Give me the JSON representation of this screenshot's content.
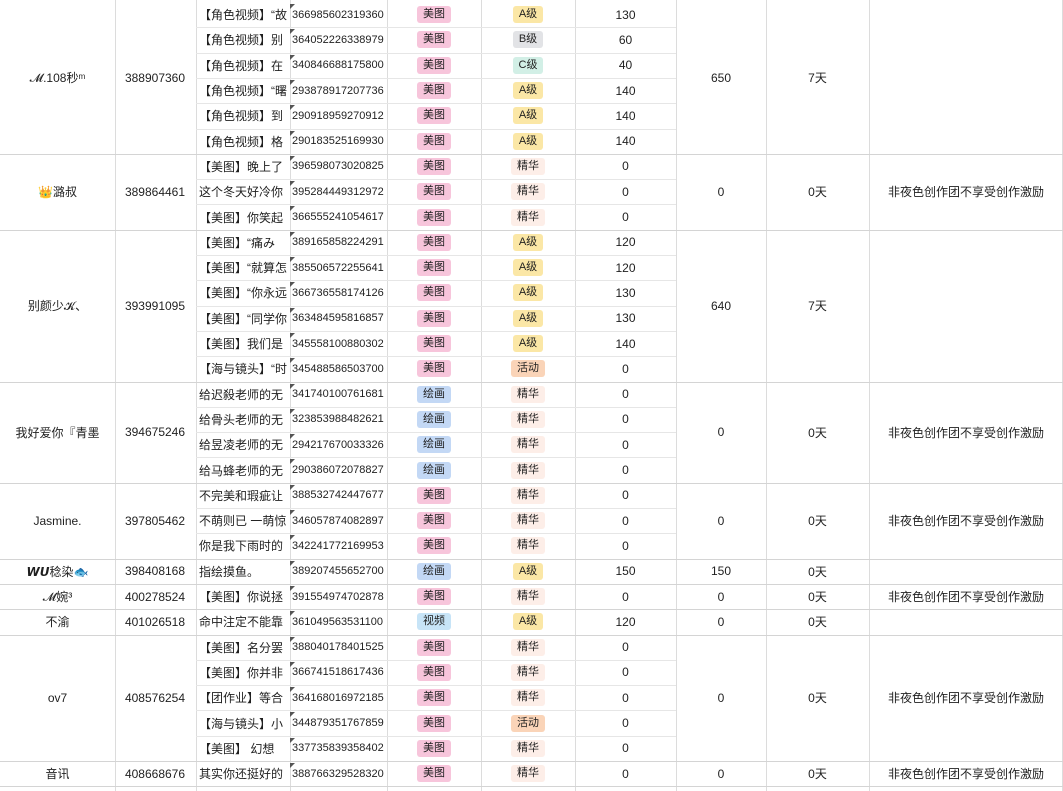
{
  "colors": {
    "tag_meitu": "#f7c5db",
    "tag_huihua": "#c3d8f5",
    "tag_shipin": "#c7e4f7",
    "grade_A": "#fbe7a6",
    "grade_B": "#e2e3e6",
    "grade_C": "#d2efe6",
    "grade_jinghua": "#fdeee8",
    "grade_huodong": "#fad4b8",
    "grid": "#dcdcdc"
  },
  "groups": [
    {
      "name": "𝓜.108秒ᵐ",
      "uid": "388907360",
      "total": "650",
      "days": "7天",
      "note": "",
      "rows": [
        {
          "title": "【角色视频】“故",
          "id": "366985602319360",
          "tag": "美图",
          "tag_color": "tag_meitu",
          "grade": "A级",
          "grade_color": "grade_A",
          "score": "130"
        },
        {
          "title": "【角色视频】别",
          "id": "364052226338979",
          "tag": "美图",
          "tag_color": "tag_meitu",
          "grade": "B级",
          "grade_color": "grade_B",
          "score": "60"
        },
        {
          "title": "【角色视频】在",
          "id": "340846688175800",
          "tag": "美图",
          "tag_color": "tag_meitu",
          "grade": "C级",
          "grade_color": "grade_C",
          "score": "40"
        },
        {
          "title": "【角色视频】“曙",
          "id": "293878917207736",
          "tag": "美图",
          "tag_color": "tag_meitu",
          "grade": "A级",
          "grade_color": "grade_A",
          "score": "140"
        },
        {
          "title": "【角色视频】到",
          "id": "290918959270912",
          "tag": "美图",
          "tag_color": "tag_meitu",
          "grade": "A级",
          "grade_color": "grade_A",
          "score": "140"
        },
        {
          "title": "【角色视频】格",
          "id": "290183525169930",
          "tag": "美图",
          "tag_color": "tag_meitu",
          "grade": "A级",
          "grade_color": "grade_A",
          "score": "140"
        }
      ]
    },
    {
      "name": "👑潞叔",
      "uid": "389864461",
      "total": "0",
      "days": "0天",
      "note": "非夜色创作团不享受创作激励",
      "rows": [
        {
          "title": "【美图】晚上了",
          "id": "396598073020825",
          "tag": "美图",
          "tag_color": "tag_meitu",
          "grade": "精华",
          "grade_color": "grade_jinghua",
          "score": "0"
        },
        {
          "title": "这个冬天好冷你",
          "id": "395284449312972",
          "tag": "美图",
          "tag_color": "tag_meitu",
          "grade": "精华",
          "grade_color": "grade_jinghua",
          "score": "0"
        },
        {
          "title": "【美图】你笑起",
          "id": "366555241054617",
          "tag": "美图",
          "tag_color": "tag_meitu",
          "grade": "精华",
          "grade_color": "grade_jinghua",
          "score": "0"
        }
      ]
    },
    {
      "name": "别颜少𝓚、",
      "uid": "393991095",
      "total": "640",
      "days": "7天",
      "note": "",
      "rows": [
        {
          "title": "【美图】“痛み",
          "id": "389165858224291",
          "tag": "美图",
          "tag_color": "tag_meitu",
          "grade": "A级",
          "grade_color": "grade_A",
          "score": "120"
        },
        {
          "title": "【美图】“就算怎",
          "id": "385506572255641",
          "tag": "美图",
          "tag_color": "tag_meitu",
          "grade": "A级",
          "grade_color": "grade_A",
          "score": "120"
        },
        {
          "title": "【美图】“你永远",
          "id": "366736558174126",
          "tag": "美图",
          "tag_color": "tag_meitu",
          "grade": "A级",
          "grade_color": "grade_A",
          "score": "130"
        },
        {
          "title": "【美图】“同学你",
          "id": "363484595816857",
          "tag": "美图",
          "tag_color": "tag_meitu",
          "grade": "A级",
          "grade_color": "grade_A",
          "score": "130"
        },
        {
          "title": "【美图】我们是",
          "id": "345558100880302",
          "tag": "美图",
          "tag_color": "tag_meitu",
          "grade": "A级",
          "grade_color": "grade_A",
          "score": "140"
        },
        {
          "title": "【海与镜头】“时",
          "id": "345488586503700",
          "tag": "美图",
          "tag_color": "tag_meitu",
          "grade": "活动",
          "grade_color": "grade_huodong",
          "score": "0"
        }
      ]
    },
    {
      "name": "我好爱你『青墨",
      "uid": "394675246",
      "total": "0",
      "days": "0天",
      "note": "非夜色创作团不享受创作激励",
      "rows": [
        {
          "title": "给迟殺老师的无",
          "id": "341740100761681",
          "tag": "绘画",
          "tag_color": "tag_huihua",
          "grade": "精华",
          "grade_color": "grade_jinghua",
          "score": "0"
        },
        {
          "title": "给骨头老师的无",
          "id": "323853988482621",
          "tag": "绘画",
          "tag_color": "tag_huihua",
          "grade": "精华",
          "grade_color": "grade_jinghua",
          "score": "0"
        },
        {
          "title": "给昱凌老师的无",
          "id": "294217670033326",
          "tag": "绘画",
          "tag_color": "tag_huihua",
          "grade": "精华",
          "grade_color": "grade_jinghua",
          "score": "0"
        },
        {
          "title": "给马蜂老师的无",
          "id": "290386072078827",
          "tag": "绘画",
          "tag_color": "tag_huihua",
          "grade": "精华",
          "grade_color": "grade_jinghua",
          "score": "0"
        }
      ]
    },
    {
      "name": "Jasmine.",
      "uid": "397805462",
      "total": "0",
      "days": "0天",
      "note": "非夜色创作团不享受创作激励",
      "rows": [
        {
          "title": "不完美和瑕疵让",
          "id": "388532742447677",
          "tag": "美图",
          "tag_color": "tag_meitu",
          "grade": "精华",
          "grade_color": "grade_jinghua",
          "score": "0"
        },
        {
          "title": "不萌则已 一萌惊",
          "id": "346057874082897",
          "tag": "美图",
          "tag_color": "tag_meitu",
          "grade": "精华",
          "grade_color": "grade_jinghua",
          "score": "0"
        },
        {
          "title": "你是我下雨时的",
          "id": "342241772169953",
          "tag": "美图",
          "tag_color": "tag_meitu",
          "grade": "精华",
          "grade_color": "grade_jinghua",
          "score": "0"
        }
      ]
    },
    {
      "name": "𝙒𝙐稔染🐟",
      "uid": "398408168",
      "total": "150",
      "days": "0天",
      "note": "",
      "rows": [
        {
          "title": "指绘摸鱼。",
          "id": "389207455652700",
          "tag": "绘画",
          "tag_color": "tag_huihua",
          "grade": "A级",
          "grade_color": "grade_A",
          "score": "150"
        }
      ]
    },
    {
      "name": "𝓜婉³",
      "uid": "400278524",
      "total": "0",
      "days": "0天",
      "note": "非夜色创作团不享受创作激励",
      "rows": [
        {
          "title": "【美图】你说拯",
          "id": "391554974702878",
          "tag": "美图",
          "tag_color": "tag_meitu",
          "grade": "精华",
          "grade_color": "grade_jinghua",
          "score": "0"
        }
      ]
    },
    {
      "name": "不渝",
      "uid": "401026518",
      "total": "0",
      "days": "0天",
      "note": "",
      "rows": [
        {
          "title": "命中注定不能靠",
          "id": "361049563531100",
          "tag": "视频",
          "tag_color": "tag_shipin",
          "grade": "A级",
          "grade_color": "grade_A",
          "score": "120"
        }
      ]
    },
    {
      "name": "ov7",
      "uid": "408576254",
      "total": "0",
      "days": "0天",
      "note": "非夜色创作团不享受创作激励",
      "rows": [
        {
          "title": "【美图】名分罢",
          "id": "388040178401525",
          "tag": "美图",
          "tag_color": "tag_meitu",
          "grade": "精华",
          "grade_color": "grade_jinghua",
          "score": "0"
        },
        {
          "title": "【美图】你并非",
          "id": "366741518617436",
          "tag": "美图",
          "tag_color": "tag_meitu",
          "grade": "精华",
          "grade_color": "grade_jinghua",
          "score": "0"
        },
        {
          "title": "【团作业】等合",
          "id": "364168016972185",
          "tag": "美图",
          "tag_color": "tag_meitu",
          "grade": "精华",
          "grade_color": "grade_jinghua",
          "score": "0"
        },
        {
          "title": "【海与镜头】小",
          "id": "344879351767859",
          "tag": "美图",
          "tag_color": "tag_meitu",
          "grade": "活动",
          "grade_color": "grade_huodong",
          "score": "0"
        },
        {
          "title": "【美图】  幻想",
          "id": "337735839358402",
          "tag": "美图",
          "tag_color": "tag_meitu",
          "grade": "精华",
          "grade_color": "grade_jinghua",
          "score": "0"
        }
      ]
    },
    {
      "name": "音讯",
      "uid": "408668676",
      "total": "0",
      "days": "0天",
      "note": "非夜色创作团不享受创作激励",
      "rows": [
        {
          "title": "其实你还挺好的",
          "id": "388766329528320",
          "tag": "美图",
          "tag_color": "tag_meitu",
          "grade": "精华",
          "grade_color": "grade_jinghua",
          "score": "0"
        }
      ]
    }
  ]
}
